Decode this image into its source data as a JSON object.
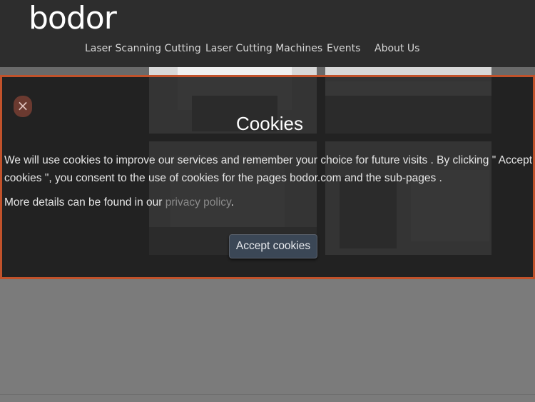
{
  "header": {
    "logo_text": "bodor",
    "nav": [
      {
        "label": "Laser Scanning Cutting"
      },
      {
        "label": "Laser Cutting Machines"
      },
      {
        "label": "Events"
      },
      {
        "label": "About Us"
      }
    ]
  },
  "cookie_modal": {
    "close_glyph": "×",
    "title": "Cookies",
    "text": "We will use cookies to improve our services and remember your choice for future visits . By clicking \" Accept cookies \", you consent to the use of cookies for the pages bodor.com and the sub-pages .",
    "more_prefix": "More details can be found in our ",
    "privacy_link": "privacy policy",
    "more_suffix": ".",
    "accept_label": "Accept cookies",
    "border_color": "#c1522b"
  }
}
